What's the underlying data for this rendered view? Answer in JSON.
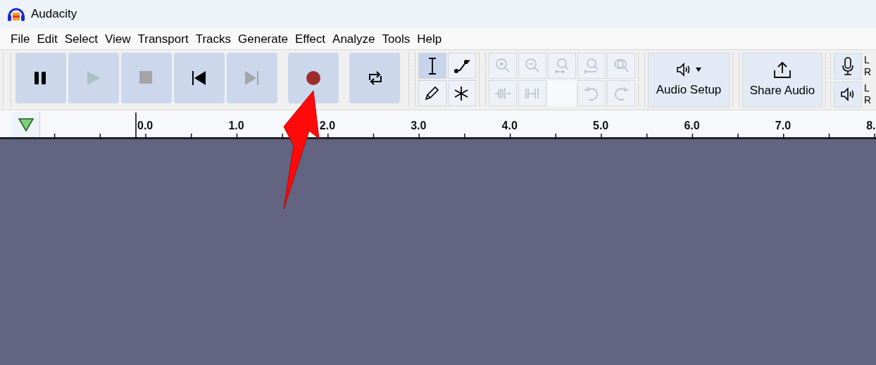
{
  "window": {
    "title": "Audacity"
  },
  "menu": [
    "File",
    "Edit",
    "Select",
    "View",
    "Transport",
    "Tracks",
    "Generate",
    "Effect",
    "Analyze",
    "Tools",
    "Help"
  ],
  "transport": [
    {
      "kind": "pause",
      "disabled": false
    },
    {
      "kind": "play",
      "disabled": true
    },
    {
      "kind": "stop",
      "disabled": true
    },
    {
      "kind": "skip-start",
      "disabled": false
    },
    {
      "kind": "skip-end",
      "disabled": true
    },
    {
      "kind": "record",
      "disabled": false
    },
    {
      "kind": "loop",
      "disabled": false
    }
  ],
  "tools": [
    {
      "kind": "select",
      "selected": true
    },
    {
      "kind": "envelope",
      "selected": false
    },
    {
      "kind": "draw",
      "selected": false
    },
    {
      "kind": "multi",
      "selected": false
    }
  ],
  "edit_tools": [
    {
      "kind": "zoom-in",
      "disabled": true
    },
    {
      "kind": "zoom-out",
      "disabled": true
    },
    {
      "kind": "fit-selection",
      "disabled": true
    },
    {
      "kind": "fit-project",
      "disabled": true
    },
    {
      "kind": "zoom-toggle",
      "disabled": true
    },
    {
      "kind": "trim",
      "disabled": true
    },
    {
      "kind": "silence",
      "disabled": true
    },
    {
      "kind": "blank"
    },
    {
      "kind": "undo",
      "disabled": true
    },
    {
      "kind": "redo",
      "disabled": true
    }
  ],
  "audio_setup": {
    "label": "Audio Setup"
  },
  "share_audio": {
    "label": "Share Audio"
  },
  "meters": [
    {
      "kind": "record",
      "channels": [
        "L",
        "R"
      ]
    },
    {
      "kind": "playback",
      "channels": [
        "L",
        "R"
      ]
    }
  ],
  "ruler": {
    "labels": [
      "0.0",
      "1.0",
      "2.0",
      "3.0",
      "4.0",
      "5.0",
      "6.0",
      "7.0",
      "8."
    ]
  },
  "annotation": {
    "kind": "arrow"
  }
}
